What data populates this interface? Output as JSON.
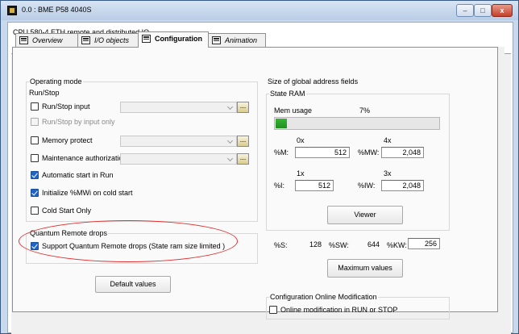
{
  "window": {
    "title": "0.0 : BME P58 4040S",
    "minimize_glyph": "–",
    "maximize_glyph": "□",
    "close_glyph": "x"
  },
  "header": {
    "description": "CPU 580-4 ETH remote and distributed IO"
  },
  "tabs": [
    {
      "label": "Overview",
      "active": false
    },
    {
      "label": "I/O objects",
      "active": false
    },
    {
      "label": "Configuration",
      "active": true
    },
    {
      "label": "Animation",
      "active": false
    }
  ],
  "operating_mode": {
    "title": "Operating mode",
    "run_stop_title": "Run/Stop",
    "run_stop_input": {
      "label": "Run/Stop input",
      "checked": false
    },
    "run_stop_by_input_only": {
      "label": "Run/Stop by input only",
      "checked": false,
      "disabled": true
    },
    "memory_protect": {
      "label": "Memory protect",
      "checked": false
    },
    "maintenance_authorization": {
      "label": "Maintenance authorization",
      "checked": false
    },
    "automatic_start": {
      "label": "Automatic start in Run",
      "checked": true
    },
    "initialize_mwi": {
      "label": "Initialize %MWi on cold start",
      "checked": true
    },
    "cold_start_only": {
      "label": "Cold Start Only",
      "checked": false
    },
    "browse_label": "..."
  },
  "quantum": {
    "title": "Quantum Remote drops",
    "support": {
      "label": "Support Quantum Remote drops (State ram size limited )",
      "checked": true
    }
  },
  "default_values_label": "Default values",
  "address_fields": {
    "title": "Size of global address fields",
    "state_ram": {
      "title": "State RAM",
      "mem_usage_label": "Mem usage",
      "mem_usage_value": "7%",
      "mem_usage_fraction": 0.07,
      "col_0x": "0x",
      "col_4x": "4x",
      "col_1x": "1x",
      "col_3x": "3x",
      "m_label": "%M:",
      "m_value": "512",
      "mw_label": "%MW:",
      "mw_value": "2,048",
      "i_label": "%I:",
      "i_value": "512",
      "iw_label": "%IW:",
      "iw_value": "2,048",
      "viewer_label": "Viewer"
    },
    "s_label": "%S:",
    "s_value": "128",
    "sw_label": "%SW:",
    "sw_value": "644",
    "kw_label": "%KW:",
    "kw_value": "256",
    "maximum_values_label": "Maximum values"
  },
  "online_mod": {
    "title": "Configuration Online Modification",
    "option": {
      "label": "Online modification in RUN or STOP",
      "checked": false
    }
  }
}
